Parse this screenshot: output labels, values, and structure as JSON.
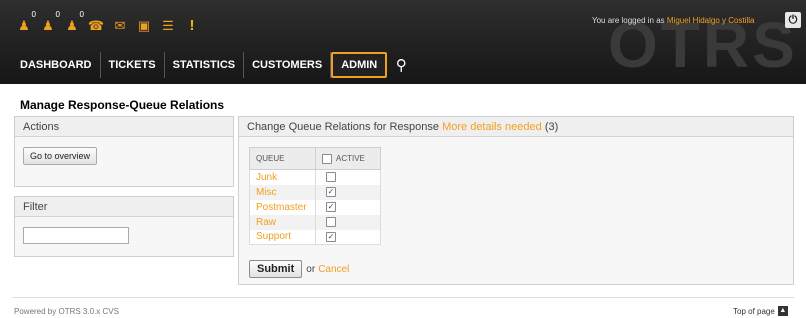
{
  "header": {
    "watermark": "OTRS",
    "toolbar": [
      {
        "icon": "locked-tickets-icon",
        "glyph": "♟",
        "count": "0"
      },
      {
        "icon": "watched-tickets-icon",
        "glyph": "♟",
        "count": "0"
      },
      {
        "icon": "responsible-tickets-icon",
        "glyph": "♟",
        "count": "0"
      },
      {
        "icon": "phone-ticket-icon",
        "glyph": "☎"
      },
      {
        "icon": "email-ticket-icon",
        "glyph": "✉"
      },
      {
        "icon": "process-ticket-icon",
        "glyph": "▣"
      },
      {
        "icon": "queue-view-icon",
        "glyph": "☰"
      },
      {
        "icon": "escalation-icon",
        "glyph": "!"
      }
    ],
    "login_prefix": "You are logged in as",
    "user_name": "Miguel Hidalgo y Costilla",
    "logout_glyph": "⏻"
  },
  "nav": {
    "items": [
      "DASHBOARD",
      "TICKETS",
      "STATISTICS",
      "CUSTOMERS",
      "ADMIN"
    ],
    "active": "ADMIN",
    "search_glyph": "⚲"
  },
  "page_title": "Manage Response-Queue Relations",
  "sidebar": {
    "actions_title": "Actions",
    "overview_button": "Go to overview",
    "filter_title": "Filter",
    "filter_value": ""
  },
  "main": {
    "heading_prefix": "Change Queue Relations for Response",
    "response_name": "More details needed",
    "response_count": "(3)",
    "col_queue": "QUEUE",
    "col_active": "ACTIVE",
    "rows": [
      {
        "queue": "Junk",
        "active": false
      },
      {
        "queue": "Misc",
        "active": true
      },
      {
        "queue": "Postmaster",
        "active": true
      },
      {
        "queue": "Raw",
        "active": false
      },
      {
        "queue": "Support",
        "active": true
      }
    ],
    "submit_label": "Submit",
    "or_label": "or",
    "cancel_label": "Cancel"
  },
  "footer": {
    "powered": "Powered by OTRS 3.0.x CVS",
    "top_of_page": "Top of page",
    "top_glyph": "▲"
  },
  "colors": {
    "accent": "#f0a020",
    "header_bg": "#1e1e1e"
  }
}
